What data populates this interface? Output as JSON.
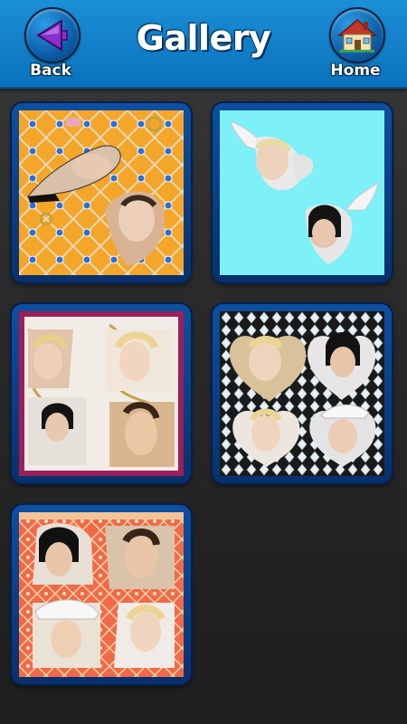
{
  "header": {
    "title": "Gallery",
    "back_label": "Back",
    "home_label": "Home",
    "back_icon": "back-arrow-icon",
    "home_icon": "house-icon",
    "colors": {
      "bar": "#0a72bd",
      "button": "#0c5ea6",
      "back_arrow": "#9b3fd6"
    }
  },
  "gallery": {
    "items": [
      {
        "name": "collage-1",
        "background": "#f4a62a",
        "thumbnail": "orange jewelry pattern with portrait in shoe and bird shapes"
      },
      {
        "name": "collage-2",
        "background": "#7ef0f7",
        "thumbnail": "cyan background with two dove shaped portraits"
      },
      {
        "name": "collage-3",
        "background": "#f2ece6",
        "thumbnail": "four portraits on cream chain pattern with magenta frame"
      },
      {
        "name": "collage-4",
        "background": "#dcdcdc",
        "thumbnail": "four heart shaped portraits on crystal gem pattern"
      },
      {
        "name": "collage-5",
        "background": "#f06a4a",
        "thumbnail": "four portraits on coral tribal pattern"
      }
    ]
  }
}
